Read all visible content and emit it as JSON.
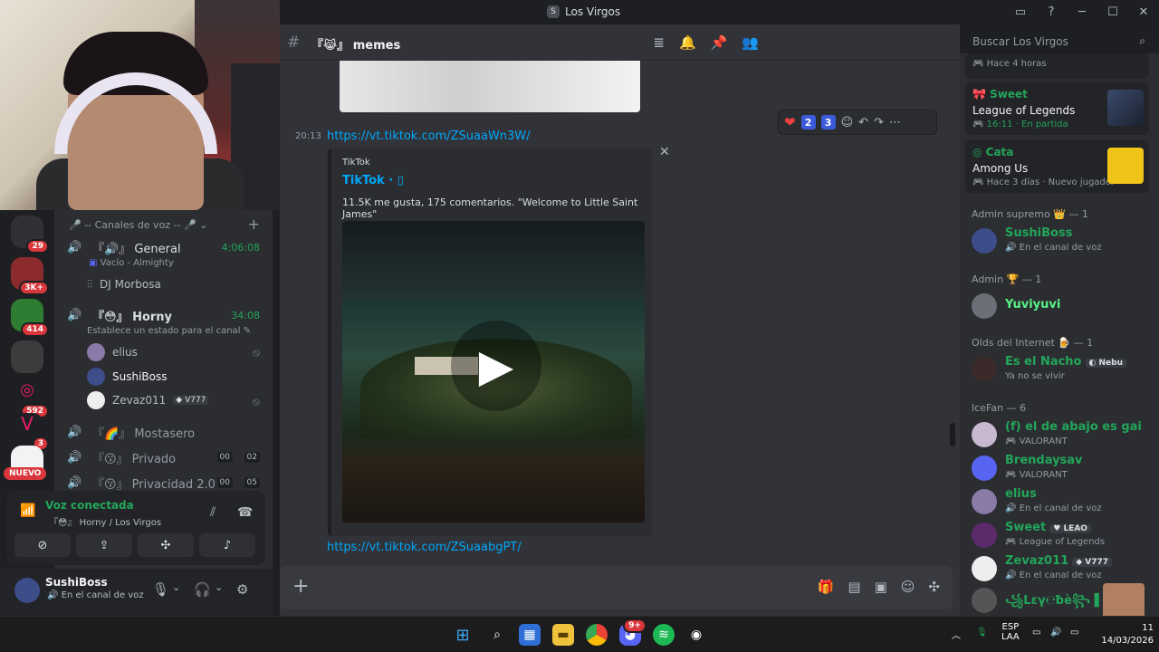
{
  "window": {
    "title": "Los Virgos"
  },
  "header": {
    "channel": "『😹』 memes",
    "search_placeholder": "Buscar Los Virgos"
  },
  "guilds": {
    "badges": [
      "29",
      "3K+",
      "414",
      "592",
      "3"
    ],
    "nuevo": "NUEVO"
  },
  "channels": {
    "category": "🎤 -- Canales de voz -- 🎤",
    "voice": [
      {
        "name": "『🔊』 General",
        "time": "4:06:08",
        "status": "Vacío - Almighty",
        "user": "DJ Morbosa"
      },
      {
        "name": "『😳』 Horny",
        "time": "34:08",
        "status": "Establece un estado para el canal"
      },
      {
        "name": "『🌈』 Mostasero"
      },
      {
        "name": "『😗』 Privado",
        "pill_a": "00",
        "pill_b": "02"
      },
      {
        "name": "『😗』 Privacidad 2.0",
        "pill_a": "00",
        "pill_b": "05"
      }
    ],
    "horny_users": [
      {
        "name": "elius"
      },
      {
        "name": "SushiBoss"
      },
      {
        "name": "Zevaz011",
        "tag": "V777"
      }
    ]
  },
  "voice_panel": {
    "title": "Voz conectada",
    "sub": "『😳』 Horny / Los Virgos"
  },
  "user_panel": {
    "name": "SushiBoss",
    "status": "En el canal de voz"
  },
  "messages": {
    "timestamp": "20:13",
    "link1": "https://vt.tiktok.com/ZSuaaWn3W/",
    "link2": "https://vt.tiktok.com/ZSuaabgPT/",
    "reactions": [
      "2",
      "3"
    ],
    "embed": {
      "provider": "TikTok",
      "title": "TikTok · ▯",
      "description": "11.5K me gusta, 175 comentarios. \"Welcome to Little Saint James\""
    }
  },
  "members": {
    "activities": [
      {
        "status": "Hace 4 horas"
      },
      {
        "name": "Sweet",
        "game": "League of Legends",
        "status": "16:11  ·  En partida"
      },
      {
        "name": "Cata",
        "game": "Among Us",
        "status": "Hace 3 días  ·  Nuevo jugador"
      }
    ],
    "groups": [
      {
        "title": "Admin supremo 👑 — 1",
        "members": [
          {
            "name": "SushiBoss",
            "status": "En el canal de voz"
          }
        ]
      },
      {
        "title": "Admin 🏆 — 1",
        "members": [
          {
            "name": "Yuviyuvi",
            "status": ""
          }
        ]
      },
      {
        "title": "Olds del Internet 🍺 — 1",
        "members": [
          {
            "name": "Es el Nacho",
            "tag": "Nebu",
            "status": "Ya no se vivir"
          }
        ]
      },
      {
        "title": "IceFan — 6",
        "members": [
          {
            "name": "(f) el de abajo es gai",
            "status": "VALORANT"
          },
          {
            "name": "Brendaysav",
            "status": "VALORANT"
          },
          {
            "name": "elius",
            "status": "En el canal de voz"
          },
          {
            "name": "Sweet",
            "tag": "LEAO",
            "status": "League of Legends"
          },
          {
            "name": "Zevaz011",
            "tag": "V777",
            "status": "En el canal de voz"
          },
          {
            "name": "꧁Lεγ℮ƀè꧂ ▌▌•✿",
            "status": ""
          }
        ]
      }
    ]
  },
  "taskbar": {
    "lang": "ESP",
    "lang2": "LAA",
    "time": "11",
    "date": "14/03/2026",
    "discord_badge": "9+"
  }
}
